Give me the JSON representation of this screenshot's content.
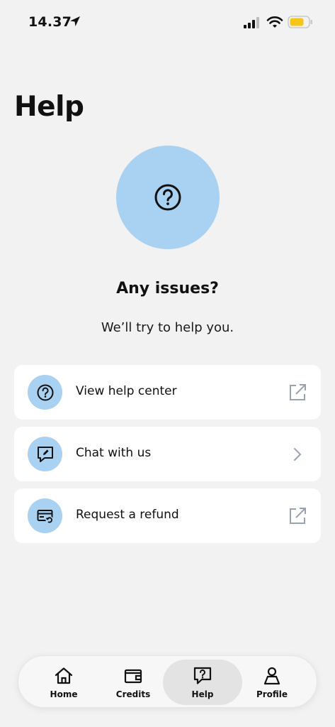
{
  "status_bar": {
    "time": "14.37"
  },
  "page": {
    "title": "Help"
  },
  "hero": {
    "icon": "question-circle-icon",
    "title": "Any issues?",
    "subtitle": "We’ll try to help you."
  },
  "actions": [
    {
      "label": "View help center",
      "icon": "question-circle-icon",
      "trailing_icon": "external-link-icon"
    },
    {
      "label": "Chat with us",
      "icon": "chat-edit-icon",
      "trailing_icon": "chevron-right-icon"
    },
    {
      "label": "Request a refund",
      "icon": "card-refund-icon",
      "trailing_icon": "external-link-icon"
    }
  ],
  "bottom_nav": {
    "items": [
      {
        "label": "Home",
        "icon": "home-icon"
      },
      {
        "label": "Credits",
        "icon": "wallet-icon"
      },
      {
        "label": "Help",
        "icon": "help-chat-icon",
        "active": true
      },
      {
        "label": "Profile",
        "icon": "person-icon"
      }
    ]
  },
  "colors": {
    "background": "#f2f2f2",
    "accent_circle": "#a9d1f2",
    "card": "#ffffff",
    "active_nav": "#e3e3e3",
    "battery": "#f5c518"
  }
}
